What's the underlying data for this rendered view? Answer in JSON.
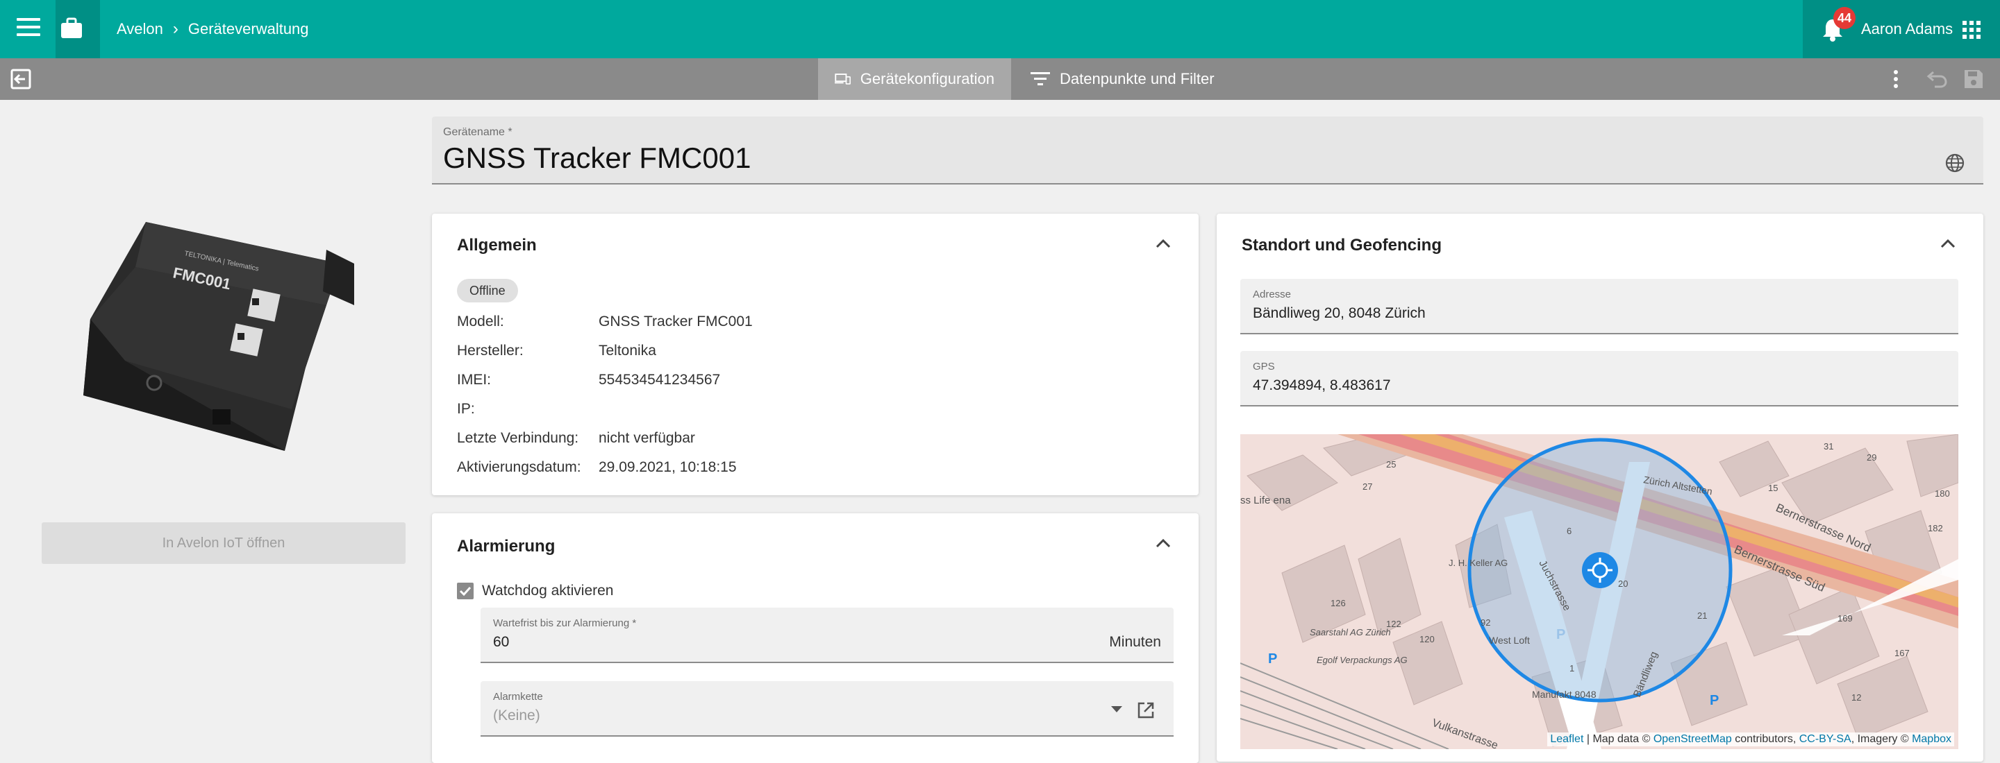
{
  "header": {
    "breadcrumb": [
      "Avelon",
      "Geräteverwaltung"
    ],
    "notifications_count": "44",
    "user_name": "Aaron Adams"
  },
  "toolbar": {
    "tabs": [
      {
        "label": "Gerätekonfiguration",
        "icon": "devices-icon",
        "active": true
      },
      {
        "label": "Datenpunkte und Filter",
        "icon": "filter-icon",
        "active": false
      }
    ]
  },
  "left": {
    "open_button_label": "In Avelon IoT öffnen"
  },
  "device_name": {
    "label": "Gerätename *",
    "value": "GNSS Tracker FMC001"
  },
  "general": {
    "title": "Allgemein",
    "status": "Offline",
    "rows": [
      {
        "key": "Modell:",
        "value": "GNSS Tracker FMC001"
      },
      {
        "key": "Hersteller:",
        "value": "Teltonika"
      },
      {
        "key": "IMEI:",
        "value": "554534541234567"
      },
      {
        "key": "IP:",
        "value": ""
      },
      {
        "key": "Letzte Verbindung:",
        "value": "nicht verfügbar"
      },
      {
        "key": "Aktivierungsdatum:",
        "value": "29.09.2021, 10:18:15"
      }
    ]
  },
  "alarm": {
    "title": "Alarmierung",
    "watchdog_label": "Watchdog aktivieren",
    "watchdog_checked": true,
    "wait_label": "Wartefrist bis zur Alarmierung *",
    "wait_value": "60",
    "wait_unit": "Minuten",
    "chain_label": "Alarmkette",
    "chain_value": "(Keine)"
  },
  "location": {
    "title": "Standort und Geofencing",
    "address_label": "Adresse",
    "address_value": "Bändliweg 20, 8048 Zürich",
    "gps_label": "GPS",
    "gps_value": "47.394894, 8.483617",
    "map_labels": {
      "street1": "Bernerstrasse Nord",
      "street2": "Bernerstrasse Süd",
      "street3": "Juchstrasse",
      "street4": "Bändliweg",
      "street5": "Vulkanstrasse",
      "station": "Zürich Altstetten",
      "poi1": "Saarstahl AG Zürich",
      "poi2": "Egolf Verpackungs AG",
      "poi3": "J. H. Keller AG",
      "poi4": "West Loft",
      "poi5": "Manufakt 8048",
      "poi6": "ss Life ena",
      "n126": "126",
      "n122": "122",
      "n120": "120",
      "n92": "92",
      "n6": "6",
      "n20": "20",
      "n21": "21",
      "n169": "169",
      "n167": "167",
      "n12": "12",
      "n182": "182",
      "n15": "15",
      "n31": "31",
      "n29": "29",
      "n25": "25",
      "n1": "1",
      "n180": "180",
      "n27": "27"
    },
    "attribution": {
      "leaflet": "Leaflet",
      "mid1": " | Map data © ",
      "osm": "OpenStreetMap",
      "mid2": " contributors, ",
      "cc": "CC-BY-SA",
      "mid3": ", Imagery © ",
      "mapbox": "Mapbox"
    }
  }
}
